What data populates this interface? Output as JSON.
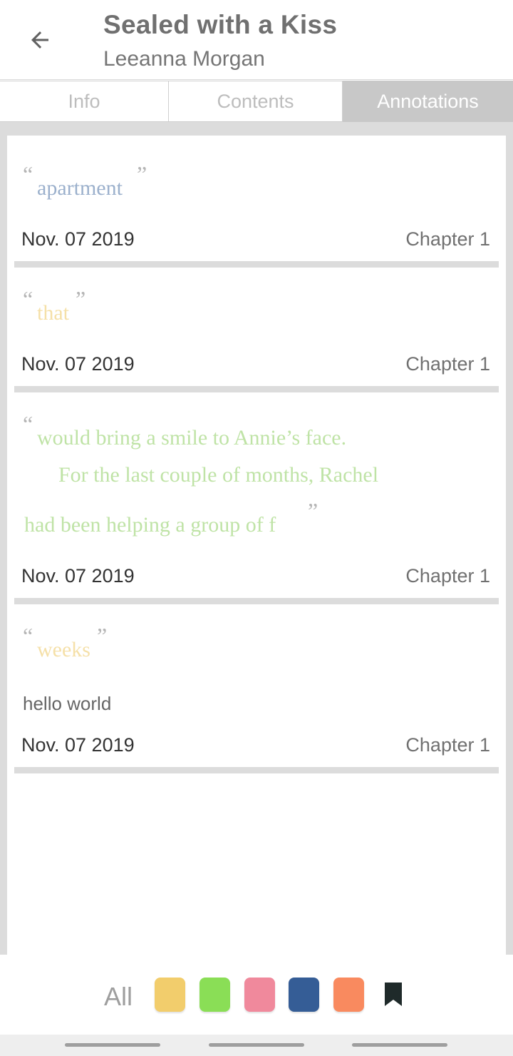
{
  "header": {
    "title": "Sealed with a Kiss",
    "author": "Leeanna Morgan",
    "back_icon": "arrow-left-icon"
  },
  "tabs": [
    {
      "label": "Info",
      "selected": false
    },
    {
      "label": "Contents",
      "selected": false
    },
    {
      "label": "Annotations",
      "selected": true
    }
  ],
  "quote_marks": {
    "open": "“",
    "close": "”"
  },
  "annotations": [
    {
      "text_lines": [
        "apartment"
      ],
      "color": "#9bb0cc",
      "note": "",
      "date": "Nov. 07 2019",
      "chapter": "Chapter 1"
    },
    {
      "text_lines": [
        "that"
      ],
      "color": "#f5e0a8",
      "note": "",
      "date": "Nov. 07 2019",
      "chapter": "Chapter 1"
    },
    {
      "text_lines": [
        "would bring a smile to Annie’s face.",
        "For the last couple of months, Rachel",
        "had been helping a group of f"
      ],
      "color": "#bfe3a6",
      "note": "",
      "date": "Nov. 07 2019",
      "chapter": "Chapter 1"
    },
    {
      "text_lines": [
        "weeks"
      ],
      "color": "#f5e0a8",
      "note": "hello world",
      "date": "Nov. 07 2019",
      "chapter": "Chapter 1"
    }
  ],
  "filter_bar": {
    "all_label": "All",
    "swatches": [
      {
        "name": "yellow",
        "color": "#f2cd6c"
      },
      {
        "name": "green",
        "color": "#8ade56"
      },
      {
        "name": "pink",
        "color": "#f0899c"
      },
      {
        "name": "blue",
        "color": "#355d96"
      },
      {
        "name": "orange",
        "color": "#f98a5f"
      }
    ],
    "bookmark_icon": "bookmark-icon",
    "bookmark_color": "#1f2a2a"
  }
}
